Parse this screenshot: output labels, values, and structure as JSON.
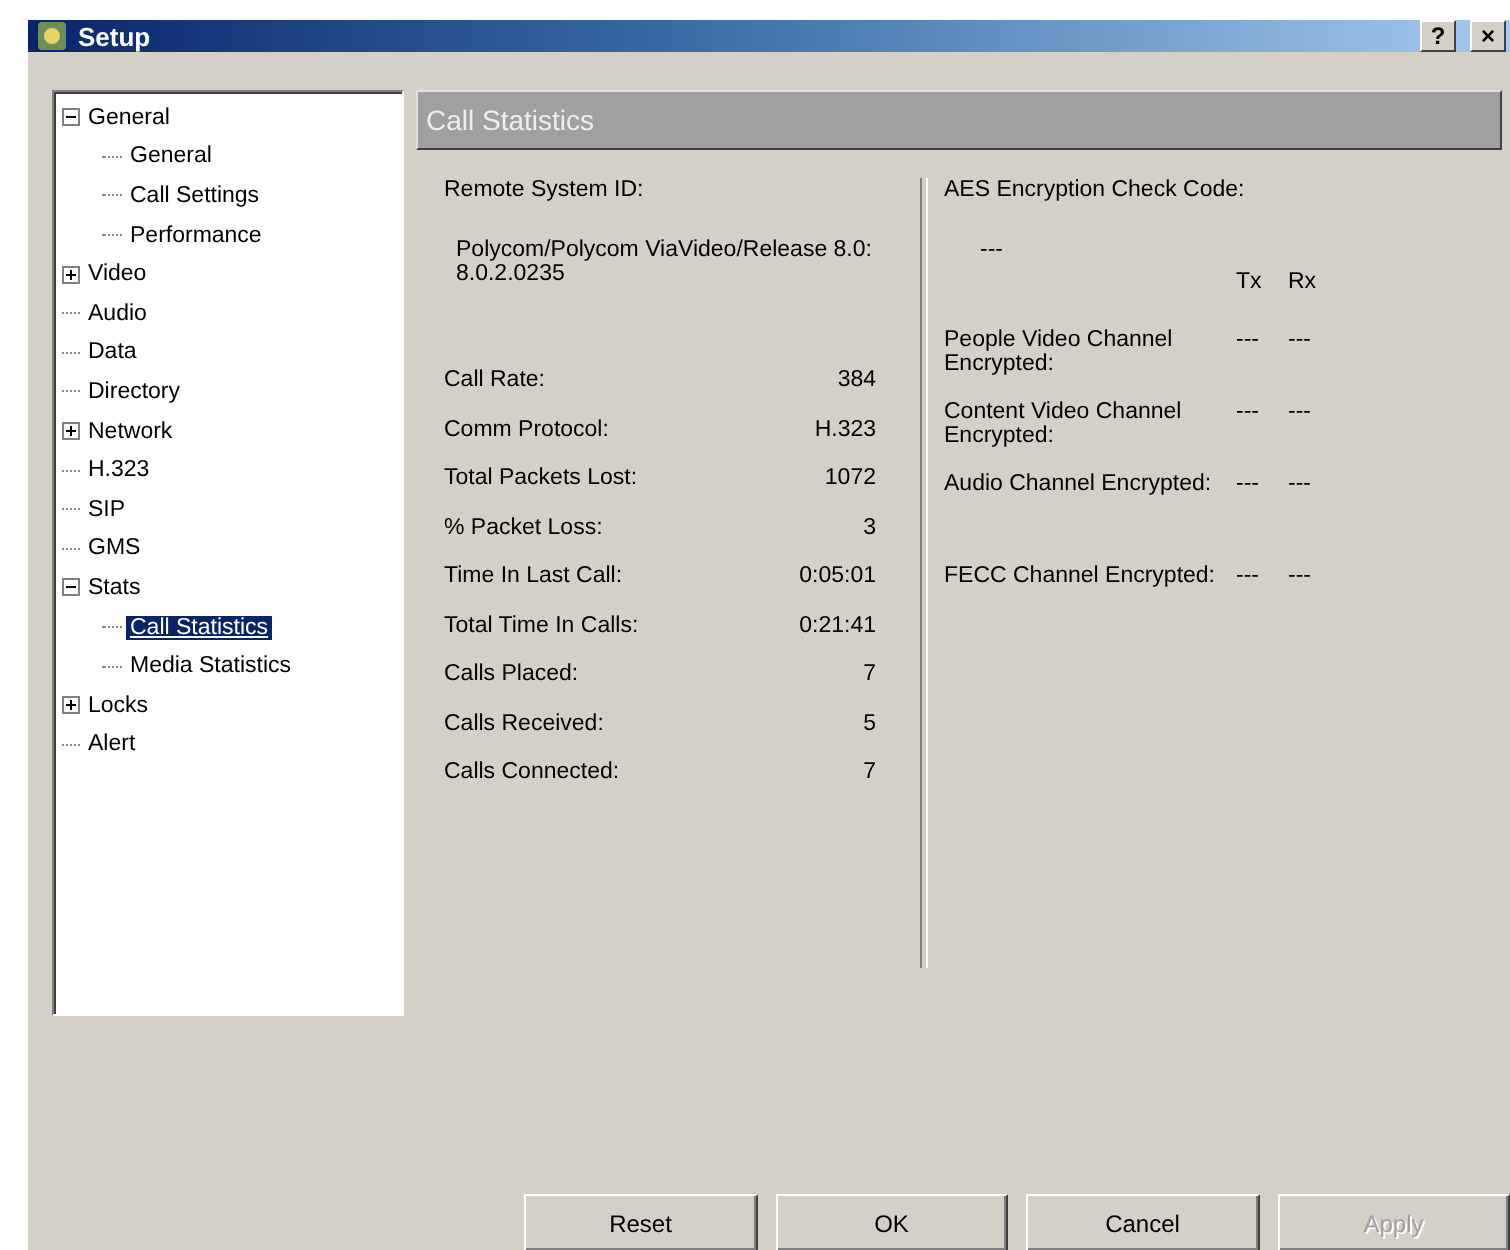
{
  "window": {
    "title": "Setup",
    "help": "?",
    "close": "×"
  },
  "tree": [
    {
      "label": "General",
      "expanded": true,
      "selected": false,
      "children": [
        {
          "label": "General",
          "selected": false
        },
        {
          "label": "Call Settings",
          "selected": false
        },
        {
          "label": "Performance",
          "selected": false
        }
      ]
    },
    {
      "label": "Video",
      "expanded": false,
      "selected": false
    },
    {
      "label": "Audio",
      "selected": false
    },
    {
      "label": "Data",
      "selected": false
    },
    {
      "label": "Directory",
      "selected": false
    },
    {
      "label": "Network",
      "expanded": false,
      "selected": false
    },
    {
      "label": "H.323",
      "selected": false
    },
    {
      "label": "SIP",
      "selected": false
    },
    {
      "label": "GMS",
      "selected": false
    },
    {
      "label": "Stats",
      "expanded": true,
      "selected": false,
      "children": [
        {
          "label": "Call Statistics",
          "selected": true
        },
        {
          "label": "Media Statistics",
          "selected": false
        }
      ]
    },
    {
      "label": "Locks",
      "expanded": false,
      "selected": false
    },
    {
      "label": "Alert",
      "selected": false
    }
  ],
  "panel": {
    "title": "Call Statistics",
    "remote_label": "Remote System ID:",
    "remote_value": "Polycom/Polycom ViaVideo/Release 8.0: 8.0.2.0235",
    "stats": [
      {
        "label": "Call Rate:",
        "value": "384"
      },
      {
        "label": "Comm Protocol:",
        "value": "H.323"
      },
      {
        "label": "Total Packets Lost:",
        "value": "1072"
      },
      {
        "label": "% Packet Loss:",
        "value": "3"
      },
      {
        "label": "Time In Last Call:",
        "value": "0:05:01"
      },
      {
        "label": "Total Time In Calls:",
        "value": "0:21:41"
      },
      {
        "label": "Calls Placed:",
        "value": "7"
      },
      {
        "label": "Calls Received:",
        "value": "5"
      },
      {
        "label": "Calls Connected:",
        "value": "7"
      }
    ],
    "aes_label": "AES Encryption Check Code:",
    "aes_value": "---",
    "tx_header": "Tx",
    "rx_header": "Rx",
    "encryption": [
      {
        "label": "People Video Channel Encrypted:",
        "tx": "---",
        "rx": "---"
      },
      {
        "label": "Content Video Channel Encrypted:",
        "tx": "---",
        "rx": "---"
      },
      {
        "label": "Audio Channel Encrypted:",
        "tx": "---",
        "rx": "---"
      },
      {
        "label": "FECC Channel Encrypted:",
        "tx": "---",
        "rx": "---"
      }
    ]
  },
  "buttons": [
    {
      "label": "Reset",
      "disabled": false
    },
    {
      "label": "OK",
      "disabled": false
    },
    {
      "label": "Cancel",
      "disabled": false
    },
    {
      "label": "Apply",
      "disabled": true
    }
  ]
}
